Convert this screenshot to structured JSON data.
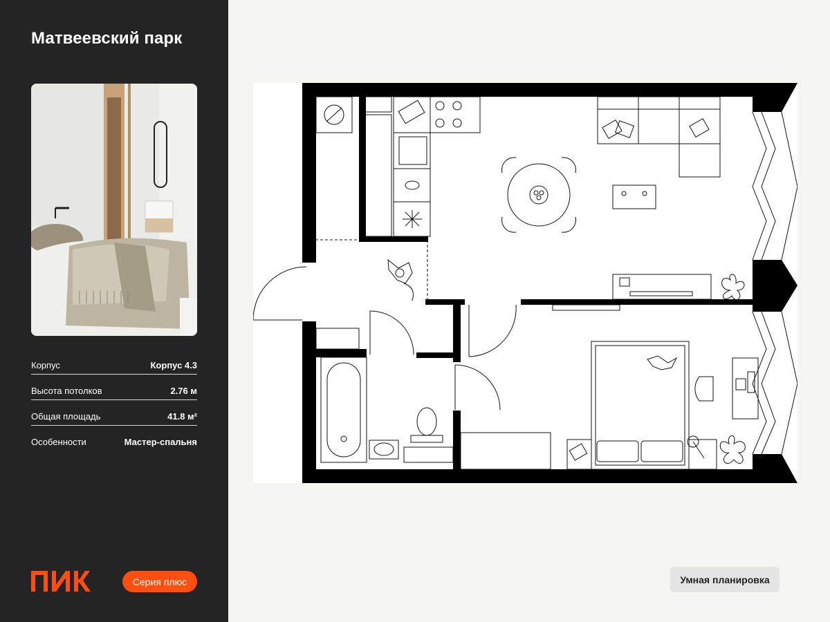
{
  "sidebar": {
    "project_title": "Матвеевский парк",
    "photo_icon": "bedroom-interior-photo",
    "specs": [
      {
        "label": "Корпус",
        "value": "Корпус 4.3"
      },
      {
        "label": "Высота потолков",
        "value": "2.76 м"
      },
      {
        "label": "Общая площадь",
        "value": "41.8 м²"
      },
      {
        "label": "Особенности",
        "value": "Мастер-спальня"
      }
    ],
    "logo_text": "ПИК",
    "series_badge": "Серия плюс"
  },
  "main": {
    "floorplan_icon": "apartment-floor-plan",
    "smart_badge": "Умная планировка"
  },
  "colors": {
    "accent": "#fe4f10",
    "sidebar_bg": "#242424",
    "page_bg": "#f5f5f3",
    "wall": "#000000"
  }
}
